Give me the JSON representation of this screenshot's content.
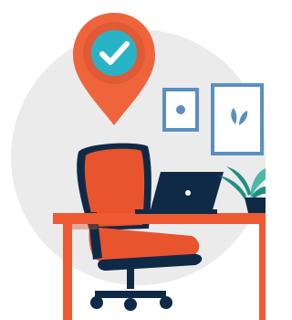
{
  "illustration": {
    "icons": {
      "pin": "location-pin-icon",
      "check": "checkmark-icon",
      "laptop": "laptop-icon",
      "plant": "plant-icon"
    },
    "colors": {
      "background": "#ffffff",
      "backdrop_circle": "#ebebeb",
      "pin_orange": "#f0643c",
      "pin_inner_ring": "#e05a36",
      "check_circle_teal": "#29b3c6",
      "check_mark": "#ffffff",
      "navy": "#0f2a47",
      "chair_orange": "#e8542d",
      "desk_orange": "#ef5a33",
      "frame_blue": "#5b8fbf",
      "frame_fill": "#ffffff",
      "plant_green": "#1f8f82",
      "plant_light": "#4fb7a8",
      "pot_navy": "#0f2a47"
    }
  }
}
